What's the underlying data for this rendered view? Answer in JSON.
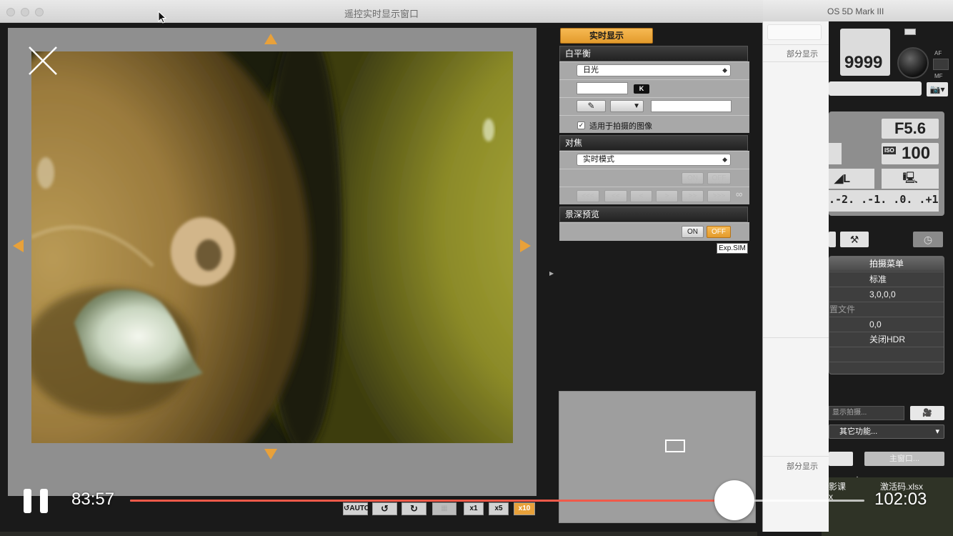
{
  "background_app": {
    "title": "OS 5D Mark III",
    "shots_remaining": "9999",
    "af_label": "AF",
    "mf_label": "MF",
    "camera_button": "📷▾",
    "aperture": "F5.6",
    "iso_tag": "ISO",
    "iso": "100",
    "quality": "◢L",
    "exposure_scale": ".-2. .-1. .0. .+1. .+2.",
    "shooting_menu": {
      "title": "拍摄菜单",
      "rows": [
        {
          "label": "",
          "value": "标准"
        },
        {
          "label": "",
          "value": "3,0,0,0"
        },
        {
          "label": "置文件",
          "value": ""
        },
        {
          "label": "",
          "value": "0,0"
        },
        {
          "label": "",
          "value": "关闭HDR"
        }
      ]
    },
    "liveview_shoot_placeholder": "显示拍摄...",
    "other_functions": "其它功能...",
    "main_window_button": "主窗口...",
    "desktop_files": [
      "影课",
      "激活码.xlsx",
      "x"
    ]
  },
  "white_window": {
    "partial_display": "部分显示"
  },
  "window": {
    "title": "遥控实时显示窗口"
  },
  "panel": {
    "live_view_button": "实时显示",
    "white_balance": {
      "heading": "白平衡",
      "mode": "日光",
      "kelvin_value": "",
      "kelvin_unit": "K",
      "apply_checkbox_label": "适用于拍摄的图像",
      "apply_checked": true
    },
    "focus": {
      "heading": "对焦",
      "mode": "实时模式",
      "on_label": "ON",
      "off_label": "OFF",
      "steps": [
        "<<<",
        "<<",
        "<",
        ">",
        ">>",
        ">>>"
      ],
      "infinity": "∞"
    },
    "dof_preview": {
      "heading": "景深预览",
      "on_label": "ON",
      "off_label": "OFF",
      "off_active": true
    },
    "exp_sim": "Exp.SIM"
  },
  "bottom_tools": {
    "auto_label": "AUTO",
    "zoom_levels": [
      "x1",
      "x5",
      "x10"
    ],
    "active_zoom": "x10"
  },
  "player": {
    "elapsed": "83:57",
    "total": "102:03",
    "progress_fraction": 0.8226,
    "colors": {
      "progress": "#f05a4a",
      "track": "#ffffff"
    }
  },
  "colors": {
    "accent": "#e8a13a",
    "panel_bg": "#a8a8a8",
    "frame_bg": "#8f8f8f"
  }
}
